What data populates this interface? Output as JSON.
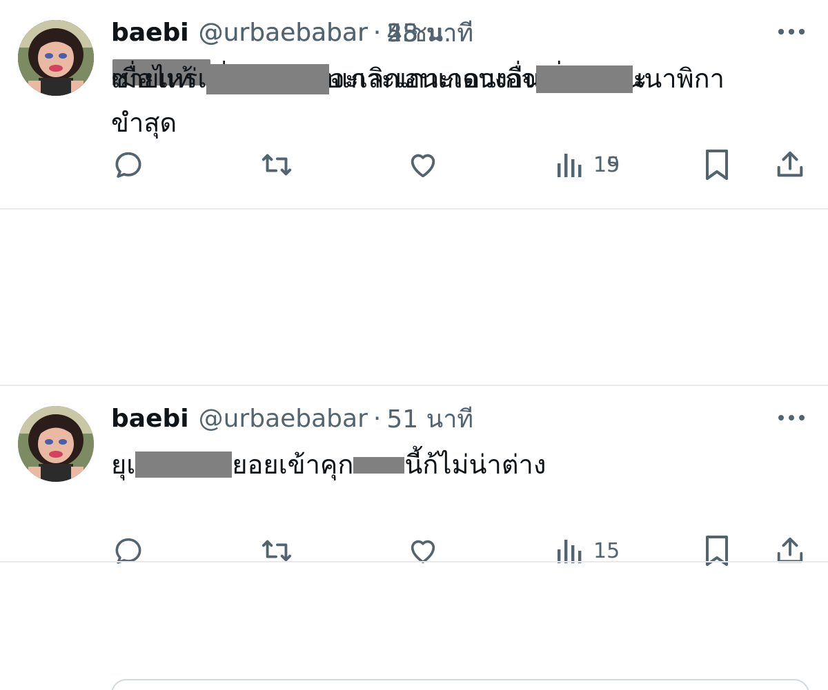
{
  "timeline": {
    "tweets": [
      {
        "display_name": "baebi",
        "handle": "@urbaebabar",
        "separator": "·",
        "time": "48 นาที",
        "text_line1": "ติ่งมันก้ชอบเกาะเอนเกดวงอื่นเรื่องแบนนาพิกา",
        "text_line2": "ขำสุด",
        "views": "15"
      },
      {
        "display_name": "baebi",
        "handle": "@urbaebabar",
        "separator": "·",
        "time": "51 นาที",
        "text_part1": "ยุเ",
        "text_part2": "ยอยเข้าคุก",
        "text_part3": "นี้ก้ไม่น่าต่าง",
        "views": "15"
      },
      {
        "display_name": "baebi",
        "handle": "@urbaebabar",
        "separator": "·",
        "time": "55 นาที",
        "text_line1": "ชายแท้",
        "views": "19"
      },
      {
        "display_name": "baebi",
        "handle": "@urbaebabar",
        "separator": "·",
        "time": "2 ชม.",
        "text_part1": "เมื่อไหร่เ",
        "text_part2": "จะเลิกเกาะเอนเกจ",
        "text_part3": "ะ"
      }
    ]
  },
  "icons": {
    "avatar": "avatar-cartoon-girl",
    "more": "more-horizontal-icon",
    "reply": "reply-icon",
    "retweet": "retweet-icon",
    "like": "like-heart-icon",
    "views": "views-bar-chart-icon",
    "bookmark": "bookmark-icon",
    "share": "share-icon"
  },
  "colors": {
    "text": "#0f1419",
    "secondary": "#536471",
    "divider": "#e7e9ec",
    "redaction": "#808080"
  }
}
